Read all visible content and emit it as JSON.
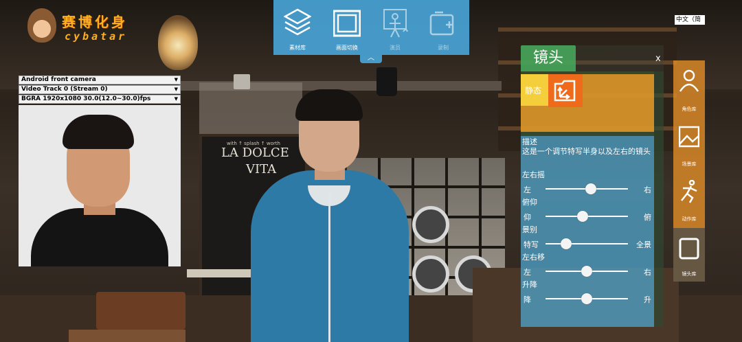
{
  "logo": {
    "text_cn": "赛博化身",
    "text_en": "cybatar"
  },
  "toolbar": {
    "items": [
      {
        "label": "素材库",
        "icon": "layers-icon"
      },
      {
        "label": "画面切换",
        "icon": "screen-switch-icon"
      },
      {
        "label": "演员",
        "icon": "actor-icon"
      },
      {
        "label": "录制",
        "icon": "record-icon"
      }
    ],
    "collapse_icon": "chevron-up-icon"
  },
  "language": {
    "selected": "中文（简"
  },
  "camera": {
    "device": "Android front camera",
    "track": "Video Track 0 (Stream 0)",
    "format": "BGRA 1920x1080 30.0(12.0~30.0)fps"
  },
  "shot_panel": {
    "title": "镜头",
    "close": "x",
    "mode_label": "静态",
    "snap_icon": "camera-angle-icon",
    "desc_label": "描述",
    "desc_text": "这是一个调节特写半身以及左右的镜头",
    "sliders": [
      {
        "name": "左右摇",
        "min_label": "左",
        "max_label": "右",
        "value": 0.55
      },
      {
        "name": "俯仰",
        "min_label": "仰",
        "max_label": "俯",
        "value": 0.45
      },
      {
        "name": "景别",
        "min_label": "特写",
        "max_label": "全景",
        "value": 0.25
      },
      {
        "name": "左右移",
        "min_label": "左",
        "max_label": "右",
        "value": 0.5
      },
      {
        "name": "升降",
        "min_label": "降",
        "max_label": "升",
        "value": 0.5
      }
    ]
  },
  "library": {
    "items": [
      {
        "label": "角色库",
        "icon": "person-icon"
      },
      {
        "label": "场景库",
        "icon": "image-icon"
      },
      {
        "label": "动作库",
        "icon": "running-icon"
      },
      {
        "label": "镜头库",
        "icon": "frame-icon",
        "active": true
      }
    ]
  },
  "scene_signs": {
    "top": "with ↑ splash ↑ worth",
    "line1": "LA DOLCE",
    "line2": "VITA"
  },
  "colors": {
    "toolbar_bg": "#4aaade",
    "panel_title": "#46a55a",
    "mode_bg": "#e19628",
    "snap_btn": "#ef6a1a",
    "library_bg": "#d78728"
  }
}
